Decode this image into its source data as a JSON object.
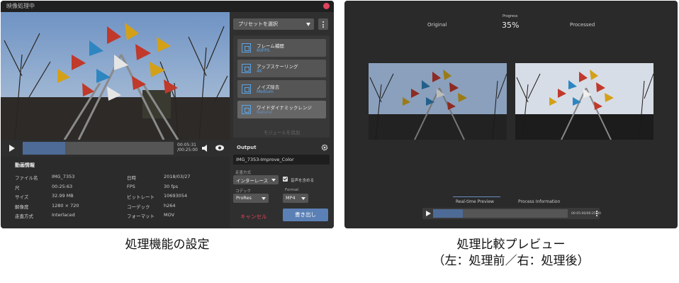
{
  "left_window": {
    "title": "映像処理中",
    "player": {
      "current_time": "00:05:31",
      "total_time": "/00:25:00",
      "progress": 0.28
    },
    "info": {
      "heading": "動画情報",
      "left_rows": [
        {
          "label": "ファイル名",
          "value": "IMG_7353"
        },
        {
          "label": "尺",
          "value": "00:25:63"
        },
        {
          "label": "サイズ",
          "value": "32.99 MB"
        },
        {
          "label": "解像度",
          "value": "1280 × 720"
        },
        {
          "label": "走査方式",
          "value": "Interlaced"
        }
      ],
      "right_rows": [
        {
          "label": "日時",
          "value": "2018/03/27"
        },
        {
          "label": "FPS",
          "value": "30 fps"
        },
        {
          "label": "ビットレート",
          "value": "10693054"
        },
        {
          "label": "コーデック",
          "value": "h264"
        },
        {
          "label": "フォーマット",
          "value": "MOV"
        }
      ]
    },
    "side": {
      "preset_label": "プリセットを選択",
      "modules": [
        {
          "name": "フレーム補間",
          "sub": "60FPS",
          "icon": "frame-interpolation-icon"
        },
        {
          "name": "アップスケーリング",
          "sub": "4K",
          "icon": "upscaling-icon"
        },
        {
          "name": "ノイズ除去",
          "sub": "Medium",
          "icon": "denoise-icon"
        },
        {
          "name": "ワイドダイナミックレンジ",
          "sub": "Natural",
          "icon": "wdr-icon"
        }
      ],
      "add_module": "モジュールを追加",
      "output_heading": "Output",
      "filename": "IMG_7353-Improve_Color",
      "scan_label": "走査方式",
      "scan_value": "インターレース",
      "audio_label": "音声を含める",
      "codec_label": "コデック",
      "codec_value": "ProRes",
      "format_label": "Format",
      "format_value": "MP4",
      "cancel": "キャンセル",
      "export": "書き出し"
    }
  },
  "right_window": {
    "original_label": "Original",
    "progress_label": "Progress",
    "progress_value": "35%",
    "processed_label": "Processed",
    "tab_preview": "Real-time Preview",
    "tab_info": "Process Information",
    "player": {
      "time": "00:05:00/00:25:00",
      "progress": 0.22
    }
  },
  "captions": {
    "left": "処理機能の設定",
    "right_line1": "処理比較プレビュー",
    "right_line2": "（左：処理前／右：処理後）"
  },
  "colors": {
    "accent": "#5b80b5",
    "danger": "#e0445b",
    "module_sub": "#5aa4e8"
  }
}
